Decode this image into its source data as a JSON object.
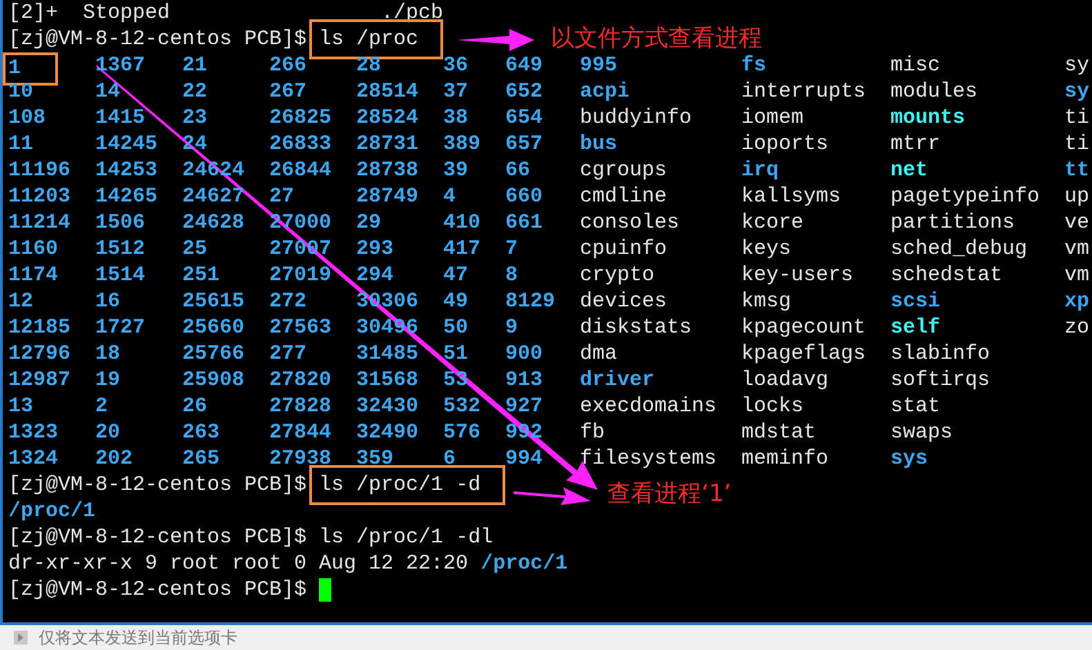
{
  "terminal": {
    "lines": [
      {
        "kind": "text",
        "parts": [
          {
            "text": "[2]+  Stopped                 ./pcb",
            "kind": "file"
          }
        ]
      },
      {
        "kind": "prompt",
        "prompt": "[zj@VM-8-12-centos PCB]$",
        "command": "ls /proc",
        "boxed": true,
        "annotation": "以文件方式查看进程"
      },
      {
        "kind": "listing",
        "rows": [
          [
            {
              "name": "1",
              "kind": "dir",
              "boxed": true
            },
            {
              "name": "1367",
              "kind": "dir",
              "boxed": false
            },
            {
              "name": "21",
              "kind": "dir",
              "boxed": false
            },
            {
              "name": "266",
              "kind": "dir",
              "boxed": false
            },
            {
              "name": "28",
              "kind": "dir",
              "boxed": false
            },
            {
              "name": "36",
              "kind": "dir",
              "boxed": false
            },
            {
              "name": "649",
              "kind": "dir",
              "boxed": false
            },
            {
              "name": "995",
              "kind": "dir",
              "boxed": false
            },
            {
              "name": "fs",
              "kind": "dir",
              "boxed": false
            },
            {
              "name": "misc",
              "kind": "file",
              "boxed": false
            },
            {
              "name": "sy",
              "kind": "file",
              "boxed": false
            }
          ],
          [
            {
              "name": "10",
              "kind": "dir",
              "boxed": false
            },
            {
              "name": "14",
              "kind": "dir",
              "boxed": false
            },
            {
              "name": "22",
              "kind": "dir",
              "boxed": false
            },
            {
              "name": "267",
              "kind": "dir",
              "boxed": false
            },
            {
              "name": "28514",
              "kind": "dir",
              "boxed": false
            },
            {
              "name": "37",
              "kind": "dir",
              "boxed": false
            },
            {
              "name": "652",
              "kind": "dir",
              "boxed": false
            },
            {
              "name": "acpi",
              "kind": "dir",
              "boxed": false
            },
            {
              "name": "interrupts",
              "kind": "file",
              "boxed": false
            },
            {
              "name": "modules",
              "kind": "file",
              "boxed": false
            },
            {
              "name": "sy",
              "kind": "dir",
              "boxed": false
            }
          ],
          [
            {
              "name": "108",
              "kind": "dir",
              "boxed": false
            },
            {
              "name": "1415",
              "kind": "dir",
              "boxed": false
            },
            {
              "name": "23",
              "kind": "dir",
              "boxed": false
            },
            {
              "name": "26825",
              "kind": "dir",
              "boxed": false
            },
            {
              "name": "28524",
              "kind": "dir",
              "boxed": false
            },
            {
              "name": "38",
              "kind": "dir",
              "boxed": false
            },
            {
              "name": "654",
              "kind": "dir",
              "boxed": false
            },
            {
              "name": "buddyinfo",
              "kind": "file",
              "boxed": false
            },
            {
              "name": "iomem",
              "kind": "file",
              "boxed": false
            },
            {
              "name": "mounts",
              "kind": "link",
              "boxed": false
            },
            {
              "name": "ti",
              "kind": "file",
              "boxed": false
            }
          ],
          [
            {
              "name": "11",
              "kind": "dir",
              "boxed": false
            },
            {
              "name": "14245",
              "kind": "dir",
              "boxed": false
            },
            {
              "name": "24",
              "kind": "dir",
              "boxed": false
            },
            {
              "name": "26833",
              "kind": "dir",
              "boxed": false
            },
            {
              "name": "28731",
              "kind": "dir",
              "boxed": false
            },
            {
              "name": "389",
              "kind": "dir",
              "boxed": false
            },
            {
              "name": "657",
              "kind": "dir",
              "boxed": false
            },
            {
              "name": "bus",
              "kind": "dir",
              "boxed": false
            },
            {
              "name": "ioports",
              "kind": "file",
              "boxed": false
            },
            {
              "name": "mtrr",
              "kind": "file",
              "boxed": false
            },
            {
              "name": "ti",
              "kind": "file",
              "boxed": false
            }
          ],
          [
            {
              "name": "11196",
              "kind": "dir",
              "boxed": false
            },
            {
              "name": "14253",
              "kind": "dir",
              "boxed": false
            },
            {
              "name": "24624",
              "kind": "dir",
              "boxed": false
            },
            {
              "name": "26844",
              "kind": "dir",
              "boxed": false
            },
            {
              "name": "28738",
              "kind": "dir",
              "boxed": false
            },
            {
              "name": "39",
              "kind": "dir",
              "boxed": false
            },
            {
              "name": "66",
              "kind": "dir",
              "boxed": false
            },
            {
              "name": "cgroups",
              "kind": "file",
              "boxed": false
            },
            {
              "name": "irq",
              "kind": "dir",
              "boxed": false
            },
            {
              "name": "net",
              "kind": "link",
              "boxed": false
            },
            {
              "name": "tt",
              "kind": "dir",
              "boxed": false
            }
          ],
          [
            {
              "name": "11203",
              "kind": "dir",
              "boxed": false
            },
            {
              "name": "14265",
              "kind": "dir",
              "boxed": false
            },
            {
              "name": "24627",
              "kind": "dir",
              "boxed": false
            },
            {
              "name": "27",
              "kind": "dir",
              "boxed": false
            },
            {
              "name": "28749",
              "kind": "dir",
              "boxed": false
            },
            {
              "name": "4",
              "kind": "dir",
              "boxed": false
            },
            {
              "name": "660",
              "kind": "dir",
              "boxed": false
            },
            {
              "name": "cmdline",
              "kind": "file",
              "boxed": false
            },
            {
              "name": "kallsyms",
              "kind": "file",
              "boxed": false
            },
            {
              "name": "pagetypeinfo",
              "kind": "file",
              "boxed": false
            },
            {
              "name": "up",
              "kind": "file",
              "boxed": false
            }
          ],
          [
            {
              "name": "11214",
              "kind": "dir",
              "boxed": false
            },
            {
              "name": "1506",
              "kind": "dir",
              "boxed": false
            },
            {
              "name": "24628",
              "kind": "dir",
              "boxed": false
            },
            {
              "name": "27000",
              "kind": "dir",
              "boxed": false
            },
            {
              "name": "29",
              "kind": "dir",
              "boxed": false
            },
            {
              "name": "410",
              "kind": "dir",
              "boxed": false
            },
            {
              "name": "661",
              "kind": "dir",
              "boxed": false
            },
            {
              "name": "consoles",
              "kind": "file",
              "boxed": false
            },
            {
              "name": "kcore",
              "kind": "file",
              "boxed": false
            },
            {
              "name": "partitions",
              "kind": "file",
              "boxed": false
            },
            {
              "name": "ve",
              "kind": "file",
              "boxed": false
            }
          ],
          [
            {
              "name": "1160",
              "kind": "dir",
              "boxed": false
            },
            {
              "name": "1512",
              "kind": "dir",
              "boxed": false
            },
            {
              "name": "25",
              "kind": "dir",
              "boxed": false
            },
            {
              "name": "27007",
              "kind": "dir",
              "boxed": false
            },
            {
              "name": "293",
              "kind": "dir",
              "boxed": false
            },
            {
              "name": "417",
              "kind": "dir",
              "boxed": false
            },
            {
              "name": "7",
              "kind": "dir",
              "boxed": false
            },
            {
              "name": "cpuinfo",
              "kind": "file",
              "boxed": false
            },
            {
              "name": "keys",
              "kind": "file",
              "boxed": false
            },
            {
              "name": "sched_debug",
              "kind": "file",
              "boxed": false
            },
            {
              "name": "vm",
              "kind": "file",
              "boxed": false
            }
          ],
          [
            {
              "name": "1174",
              "kind": "dir",
              "boxed": false
            },
            {
              "name": "1514",
              "kind": "dir",
              "boxed": false
            },
            {
              "name": "251",
              "kind": "dir",
              "boxed": false
            },
            {
              "name": "27019",
              "kind": "dir",
              "boxed": false
            },
            {
              "name": "294",
              "kind": "dir",
              "boxed": false
            },
            {
              "name": "47",
              "kind": "dir",
              "boxed": false
            },
            {
              "name": "8",
              "kind": "dir",
              "boxed": false
            },
            {
              "name": "crypto",
              "kind": "file",
              "boxed": false
            },
            {
              "name": "key-users",
              "kind": "file",
              "boxed": false
            },
            {
              "name": "schedstat",
              "kind": "file",
              "boxed": false
            },
            {
              "name": "vm",
              "kind": "file",
              "boxed": false
            }
          ],
          [
            {
              "name": "12",
              "kind": "dir",
              "boxed": false
            },
            {
              "name": "16",
              "kind": "dir",
              "boxed": false
            },
            {
              "name": "25615",
              "kind": "dir",
              "boxed": false
            },
            {
              "name": "272",
              "kind": "dir",
              "boxed": false
            },
            {
              "name": "30306",
              "kind": "dir",
              "boxed": false
            },
            {
              "name": "49",
              "kind": "dir",
              "boxed": false
            },
            {
              "name": "8129",
              "kind": "dir",
              "boxed": false
            },
            {
              "name": "devices",
              "kind": "file",
              "boxed": false
            },
            {
              "name": "kmsg",
              "kind": "file",
              "boxed": false
            },
            {
              "name": "scsi",
              "kind": "dir",
              "boxed": false
            },
            {
              "name": "xp",
              "kind": "dir",
              "boxed": false
            }
          ],
          [
            {
              "name": "12185",
              "kind": "dir",
              "boxed": false
            },
            {
              "name": "1727",
              "kind": "dir",
              "boxed": false
            },
            {
              "name": "25660",
              "kind": "dir",
              "boxed": false
            },
            {
              "name": "27563",
              "kind": "dir",
              "boxed": false
            },
            {
              "name": "30496",
              "kind": "dir",
              "boxed": false
            },
            {
              "name": "50",
              "kind": "dir",
              "boxed": false
            },
            {
              "name": "9",
              "kind": "dir",
              "boxed": false
            },
            {
              "name": "diskstats",
              "kind": "file",
              "boxed": false
            },
            {
              "name": "kpagecount",
              "kind": "file",
              "boxed": false
            },
            {
              "name": "self",
              "kind": "link",
              "boxed": false
            },
            {
              "name": "zo",
              "kind": "file",
              "boxed": false
            }
          ],
          [
            {
              "name": "12796",
              "kind": "dir",
              "boxed": false
            },
            {
              "name": "18",
              "kind": "dir",
              "boxed": false
            },
            {
              "name": "25766",
              "kind": "dir",
              "boxed": false
            },
            {
              "name": "277",
              "kind": "dir",
              "boxed": false
            },
            {
              "name": "31485",
              "kind": "dir",
              "boxed": false
            },
            {
              "name": "51",
              "kind": "dir",
              "boxed": false
            },
            {
              "name": "900",
              "kind": "dir",
              "boxed": false
            },
            {
              "name": "dma",
              "kind": "file",
              "boxed": false
            },
            {
              "name": "kpageflags",
              "kind": "file",
              "boxed": false
            },
            {
              "name": "slabinfo",
              "kind": "file",
              "boxed": false
            }
          ],
          [
            {
              "name": "12987",
              "kind": "dir",
              "boxed": false
            },
            {
              "name": "19",
              "kind": "dir",
              "boxed": false
            },
            {
              "name": "25908",
              "kind": "dir",
              "boxed": false
            },
            {
              "name": "27820",
              "kind": "dir",
              "boxed": false
            },
            {
              "name": "31568",
              "kind": "dir",
              "boxed": false
            },
            {
              "name": "53",
              "kind": "dir",
              "boxed": false
            },
            {
              "name": "913",
              "kind": "dir",
              "boxed": false
            },
            {
              "name": "driver",
              "kind": "dir",
              "boxed": false
            },
            {
              "name": "loadavg",
              "kind": "file",
              "boxed": false
            },
            {
              "name": "softirqs",
              "kind": "file",
              "boxed": false
            }
          ],
          [
            {
              "name": "13",
              "kind": "dir",
              "boxed": false
            },
            {
              "name": "2",
              "kind": "dir",
              "boxed": false
            },
            {
              "name": "26",
              "kind": "dir",
              "boxed": false
            },
            {
              "name": "27828",
              "kind": "dir",
              "boxed": false
            },
            {
              "name": "32430",
              "kind": "dir",
              "boxed": false
            },
            {
              "name": "532",
              "kind": "dir",
              "boxed": false
            },
            {
              "name": "927",
              "kind": "dir",
              "boxed": false
            },
            {
              "name": "execdomains",
              "kind": "file",
              "boxed": false
            },
            {
              "name": "locks",
              "kind": "file",
              "boxed": false
            },
            {
              "name": "stat",
              "kind": "file",
              "boxed": false
            }
          ],
          [
            {
              "name": "1323",
              "kind": "dir",
              "boxed": false
            },
            {
              "name": "20",
              "kind": "dir",
              "boxed": false
            },
            {
              "name": "263",
              "kind": "dir",
              "boxed": false
            },
            {
              "name": "27844",
              "kind": "dir",
              "boxed": false
            },
            {
              "name": "32490",
              "kind": "dir",
              "boxed": false
            },
            {
              "name": "576",
              "kind": "dir",
              "boxed": false
            },
            {
              "name": "992",
              "kind": "dir",
              "boxed": false
            },
            {
              "name": "fb",
              "kind": "file",
              "boxed": false
            },
            {
              "name": "mdstat",
              "kind": "file",
              "boxed": false
            },
            {
              "name": "swaps",
              "kind": "file",
              "boxed": false
            }
          ],
          [
            {
              "name": "1324",
              "kind": "dir",
              "boxed": false
            },
            {
              "name": "202",
              "kind": "dir",
              "boxed": false
            },
            {
              "name": "265",
              "kind": "dir",
              "boxed": false
            },
            {
              "name": "27938",
              "kind": "dir",
              "boxed": false
            },
            {
              "name": "359",
              "kind": "dir",
              "boxed": false
            },
            {
              "name": "6",
              "kind": "dir",
              "boxed": false
            },
            {
              "name": "994",
              "kind": "dir",
              "boxed": false
            },
            {
              "name": "filesystems",
              "kind": "file",
              "boxed": false
            },
            {
              "name": "meminfo",
              "kind": "file",
              "boxed": false
            },
            {
              "name": "sys",
              "kind": "dir",
              "boxed": false
            }
          ]
        ]
      },
      {
        "kind": "prompt",
        "prompt": "[zj@VM-8-12-centos PCB]$",
        "command": "ls /proc/1 -d",
        "boxed": true,
        "annotation": "查看进程‘1’"
      },
      {
        "kind": "text",
        "parts": [
          {
            "text": "/proc/1",
            "kind": "dir"
          }
        ]
      },
      {
        "kind": "prompt",
        "prompt": "[zj@VM-8-12-centos PCB]$",
        "command": "ls /proc/1 -dl",
        "boxed": false
      },
      {
        "kind": "text",
        "parts": [
          {
            "text": "dr-xr-xr-x 9 root root 0 Aug 12 22:20 ",
            "kind": "file"
          },
          {
            "text": "/proc/1",
            "kind": "dir"
          }
        ]
      },
      {
        "kind": "prompt",
        "prompt": "[zj@VM-8-12-centos PCB]$",
        "cursor": true
      }
    ]
  },
  "input_bar": {
    "text": "仅将文本发送到当前选项卡"
  }
}
